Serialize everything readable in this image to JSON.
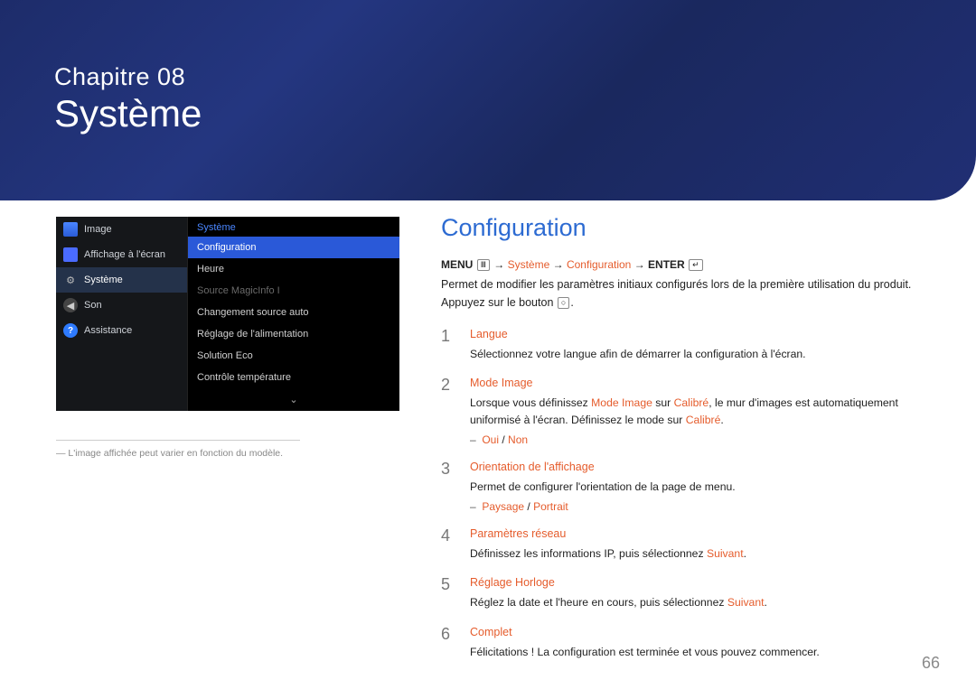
{
  "chapter": {
    "label": "Chapitre 08",
    "title": "Système"
  },
  "tv_menu": {
    "left": [
      {
        "icon": "image-icon",
        "label": "Image"
      },
      {
        "icon": "screen-icon",
        "label": "Affichage à l'écran"
      },
      {
        "icon": "gear-icon",
        "label": "Système",
        "selected": true
      },
      {
        "icon": "sound-icon",
        "label": "Son"
      },
      {
        "icon": "help-icon",
        "label": "Assistance"
      }
    ],
    "right_header": "Système",
    "right": [
      {
        "label": "Configuration",
        "highlight": true
      },
      {
        "label": "Heure"
      },
      {
        "label": "Source MagicInfo I",
        "disabled": true
      },
      {
        "label": "Changement source auto"
      },
      {
        "label": "Réglage de l'alimentation"
      },
      {
        "label": "Solution Eco"
      },
      {
        "label": "Contrôle température"
      }
    ],
    "more_arrow": "⌄"
  },
  "footnote": "―  L'image affichée peut varier en fonction du modèle.",
  "right_content": {
    "heading": "Configuration",
    "breadcrumb": {
      "menu": "MENU",
      "arrow": "→",
      "sys": "Système",
      "conf": "Configuration",
      "enter": "ENTER"
    },
    "intro_a": "Permet de modifier les paramètres initiaux configurés lors de la première utilisation du produit. Appuyez sur le bouton ",
    "intro_b": ".",
    "steps": [
      {
        "title": "Langue",
        "body": "Sélectionnez votre langue afin de démarrer la configuration à l'écran."
      },
      {
        "title": "Mode Image",
        "body_a": "Lorsque vous définissez ",
        "body_b": "Mode Image",
        "body_c": " sur ",
        "body_d": "Calibré",
        "body_e": ", le mur d'images est automatiquement uniformisé à l'écran. Définissez le mode sur ",
        "body_f": "Calibré",
        "body_g": ".",
        "options_a": "Oui",
        "options_sep": " / ",
        "options_b": "Non"
      },
      {
        "title": "Orientation de l'affichage",
        "body": "Permet de configurer l'orientation de la page de menu.",
        "options_a": "Paysage",
        "options_sep": " / ",
        "options_b": "Portrait"
      },
      {
        "title": "Paramètres réseau",
        "body_a": "Définissez les informations IP, puis sélectionnez ",
        "body_b": "Suivant",
        "body_c": "."
      },
      {
        "title": "Réglage Horloge",
        "body_a": "Réglez la date et l'heure en cours, puis sélectionnez ",
        "body_b": "Suivant",
        "body_c": "."
      },
      {
        "title": "Complet",
        "body": "Félicitations ! La configuration est terminée et vous pouvez commencer."
      }
    ]
  },
  "page_number": "66"
}
